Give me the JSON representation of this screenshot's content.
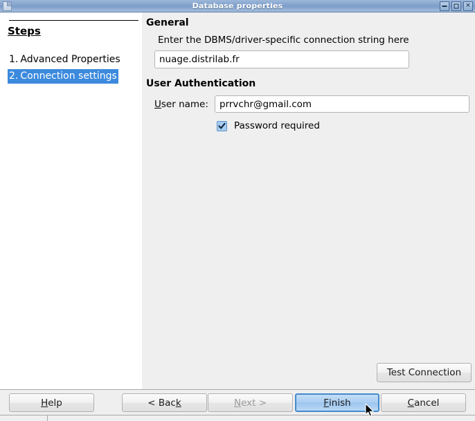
{
  "window": {
    "title": "Database properties",
    "icon": "document-icon",
    "controls": {
      "minimize": "minimize-icon",
      "maximize": "maximize-icon",
      "close": "✕"
    }
  },
  "sidebar": {
    "heading": "Steps",
    "items": [
      {
        "number": "1.",
        "label": "Advanced Properties",
        "selected": false
      },
      {
        "number": "2.",
        "label": "Connection settings",
        "selected": true
      }
    ],
    "selected_color": "#3c8add"
  },
  "main": {
    "general": {
      "title": "General",
      "description": "Enter the DBMS/driver-specific connection string here",
      "connection_string": {
        "value": "nuage.distrilab.fr",
        "placeholder": ""
      }
    },
    "user_authentication": {
      "title": "User Authentication",
      "user_name_label_prefix": "U",
      "user_name_label_rest": "ser name:",
      "user_name": {
        "value": "prrvchr@gmail.com",
        "placeholder": ""
      },
      "password_required": {
        "label": "Password required",
        "checked": true
      }
    },
    "test_connection_label": "Test Connection"
  },
  "footer": {
    "help": {
      "pre": "H",
      "mn": "",
      "label_pre": "",
      "label": "Help"
    },
    "buttons": [
      {
        "name": "help-button",
        "text_before": "H",
        "text_after": "elp",
        "mnemonic": "H",
        "disabled": false,
        "default": false
      },
      {
        "name": "back-button",
        "text_before": "< Bac",
        "text_after": "",
        "mnemonic": "k",
        "disabled": false,
        "default": false
      },
      {
        "name": "next-button",
        "text_before": "",
        "text_after": "ext >",
        "mnemonic": "N",
        "disabled": true,
        "default": false
      },
      {
        "name": "finish-button",
        "text_before": "",
        "text_after": "inish",
        "mnemonic": "F",
        "disabled": false,
        "default": true
      },
      {
        "name": "cancel-button",
        "text_before": "",
        "text_after": "ancel",
        "mnemonic": "C",
        "disabled": false,
        "default": false
      }
    ],
    "help_label": "Help",
    "back_label": "< Back",
    "next_label": "Next >",
    "finish_label": "Finish",
    "cancel_label": "Cancel"
  }
}
